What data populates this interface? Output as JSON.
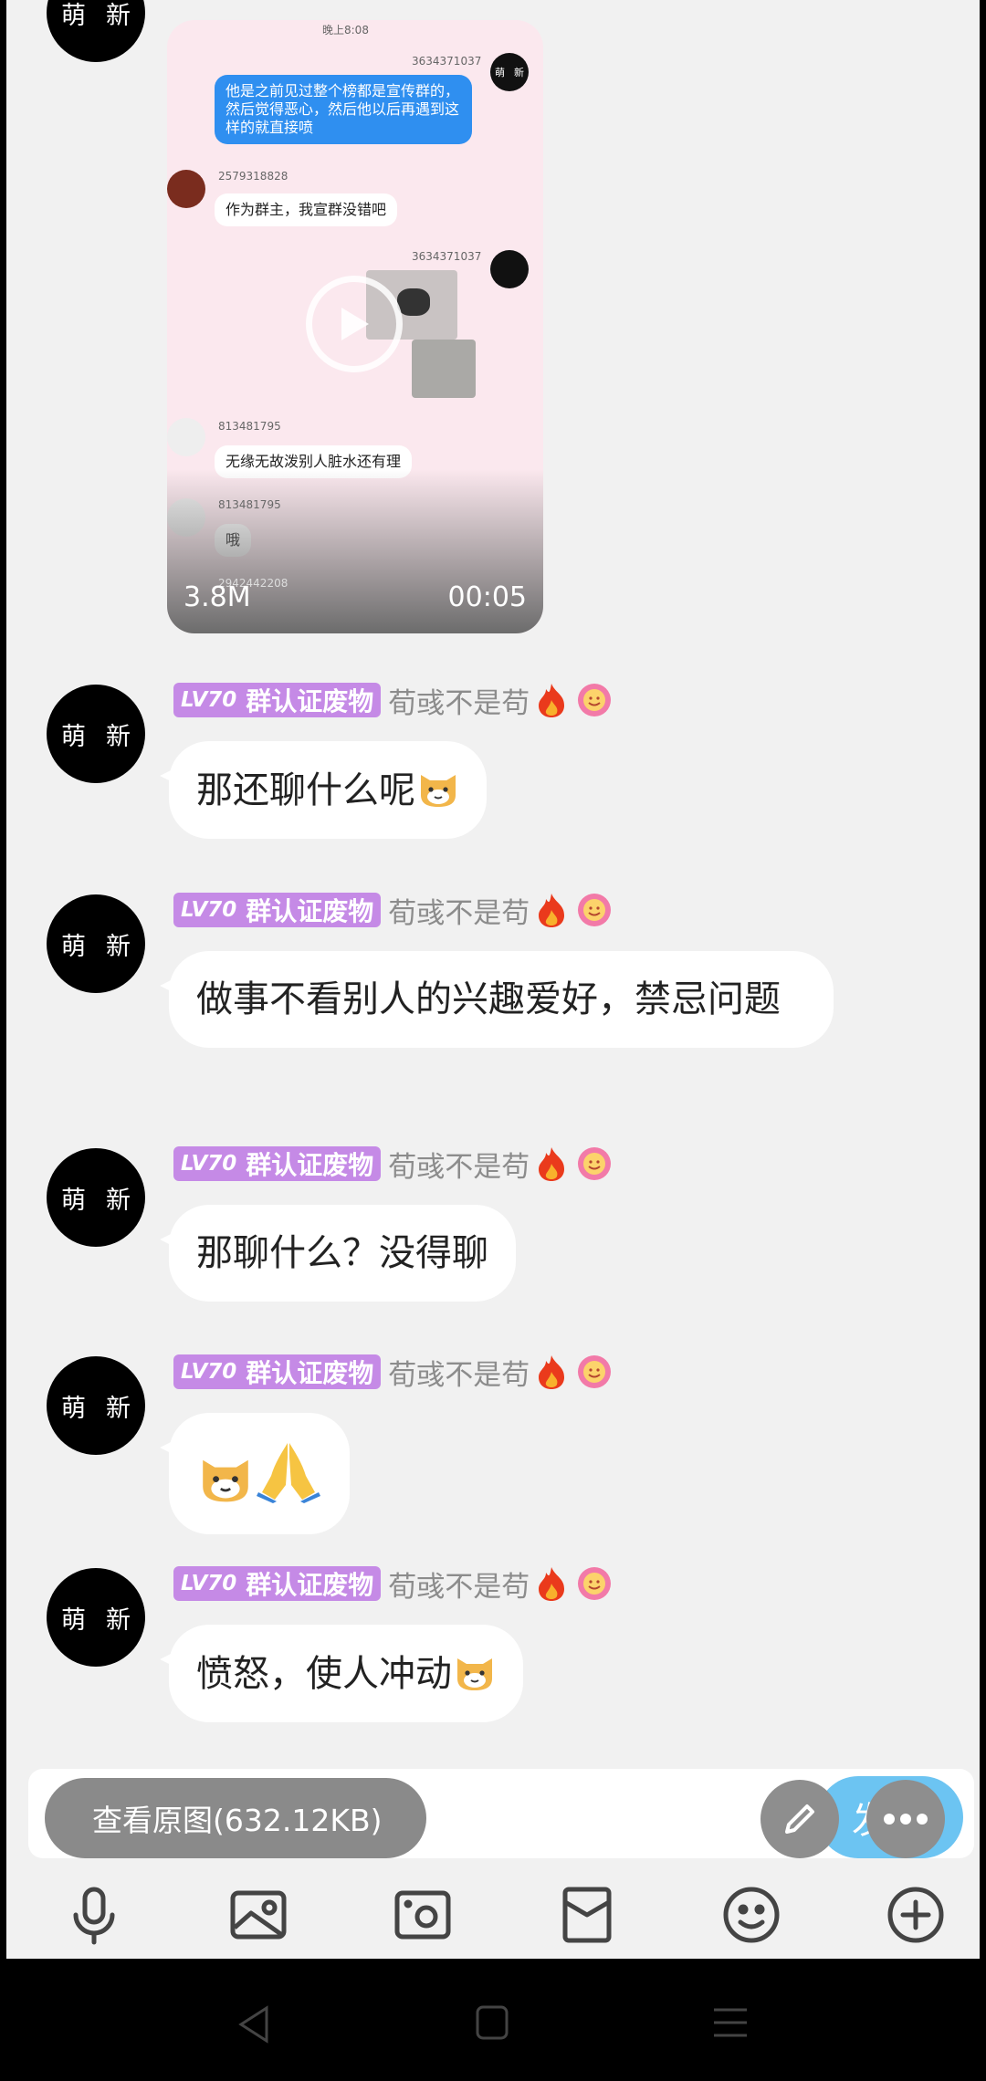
{
  "messages": [
    {
      "avatar_l": "萌",
      "avatar_r": "新",
      "level": "LV70",
      "title": "群认证废物",
      "nickname": "荀彧不是苟",
      "text": "那还聊什么呢",
      "emoji": "dog"
    },
    {
      "avatar_l": "萌",
      "avatar_r": "新",
      "level": "LV70",
      "title": "群认证废物",
      "nickname": "荀彧不是苟",
      "text": "做事不看别人的兴趣爱好，禁忌问题"
    },
    {
      "avatar_l": "萌",
      "avatar_r": "新",
      "level": "LV70",
      "title": "群认证废物",
      "nickname": "荀彧不是苟",
      "text": "那聊什么？没得聊"
    },
    {
      "avatar_l": "萌",
      "avatar_r": "新",
      "level": "LV70",
      "title": "群认证废物",
      "nickname": "荀彧不是苟",
      "text": "",
      "emoji": "dog+pray"
    },
    {
      "avatar_l": "萌",
      "avatar_r": "新",
      "level": "LV70",
      "title": "群认证废物",
      "nickname": "荀彧不是苟",
      "text": "愤怒，使人冲动",
      "emoji": "dog"
    }
  ],
  "top_avatar": {
    "l": "萌",
    "r": "新"
  },
  "video": {
    "size": "3.8M",
    "duration": "00:05",
    "inner": {
      "time": "晚上8:08",
      "ids": [
        "3634371037",
        "2579318828",
        "3634371037",
        "813481795",
        "813481795",
        "2942442208"
      ],
      "texts": [
        "他是之前见过整个榜都是宣传群的，然后觉得恶心，然后他以后再遇到这样的就直接喷",
        "作为群主，我宣群没错吧",
        "无缘无故泼别人脏水还有理",
        "哦"
      ],
      "avatar_l": "萌",
      "avatar_r": "新"
    }
  },
  "composer": {
    "view_original": "查看原图(632.12KB)",
    "send": "发送"
  },
  "icons": [
    "microphone-icon",
    "image-icon",
    "camera-icon",
    "red-packet-icon",
    "emoji-icon",
    "plus-icon"
  ],
  "colors": {
    "badge": "#c58ae6",
    "send": "#6cc4f2",
    "bubble": "#ffffff",
    "background": "#f1f1f1"
  }
}
